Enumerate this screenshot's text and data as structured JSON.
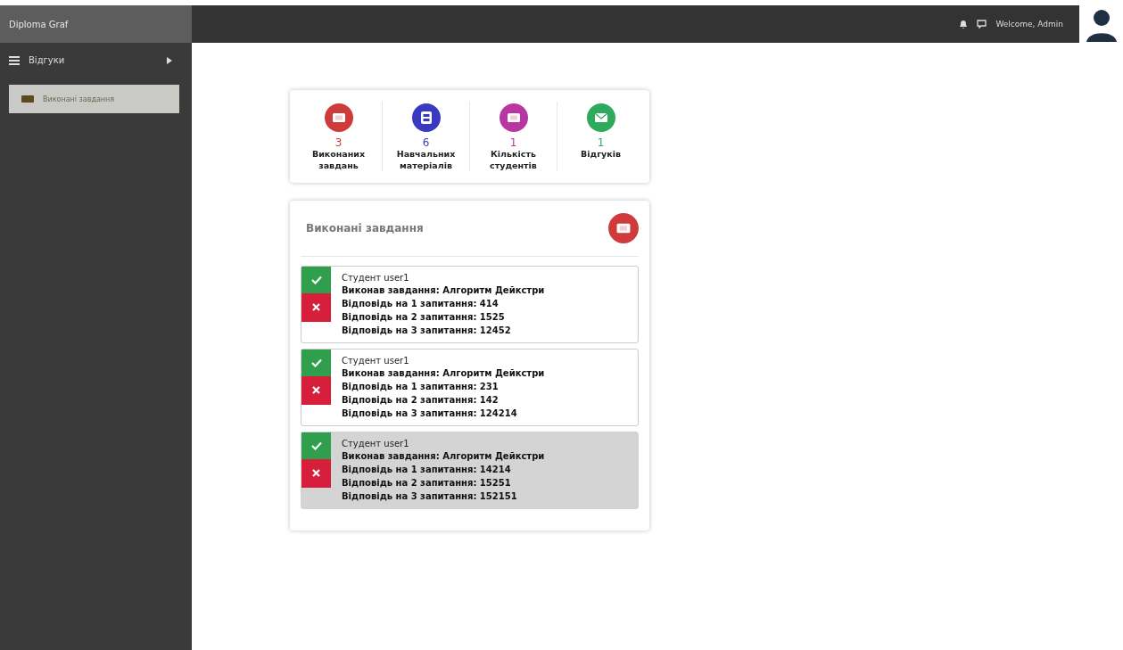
{
  "brand": "Diploma Graf",
  "header": {
    "welcome": "Welcome, Admin"
  },
  "sidebar": {
    "menu": {
      "label": "Відгуки",
      "expanded": false
    },
    "items": [
      {
        "label": "Виконані завдання",
        "selected": true
      }
    ]
  },
  "stats": [
    {
      "value": "3",
      "label": "Виконаних завдань",
      "color": "#cf3b3b",
      "kind": "ticket"
    },
    {
      "value": "6",
      "label": "Навчальних матеріалів",
      "color": "#3a3ac0",
      "kind": "film"
    },
    {
      "value": "1",
      "label": "Кількість студентів",
      "color": "#b8369f",
      "kind": "ticket"
    },
    {
      "value": "1",
      "label": "Відгуків",
      "color": "#2eaa5c",
      "kind": "mail"
    }
  ],
  "tasks": {
    "title": "Виконані завдання",
    "entries": [
      {
        "student": "Студент user1",
        "task": "Виконав завдання: Алгоритм Дейкстри",
        "answers": [
          "Відповідь на 1 запитання: 414",
          "Відповідь на 2 запитання: 1525",
          "Відповідь на 3 запитання: 12452"
        ],
        "selected": false
      },
      {
        "student": "Студент user1",
        "task": "Виконав завдання: Алгоритм Дейкстри",
        "answers": [
          "Відповідь на 1 запитання: 231",
          "Відповідь на 2 запитання: 142",
          "Відповідь на 3 запитання: 124214"
        ],
        "selected": false
      },
      {
        "student": "Студент user1",
        "task": "Виконав завдання: Алгоритм Дейкстри",
        "answers": [
          "Відповідь на 1 запитання: 14214",
          "Відповідь на 2 запитання: 15251",
          "Відповідь на 3 запитання: 152151"
        ],
        "selected": true
      }
    ]
  }
}
